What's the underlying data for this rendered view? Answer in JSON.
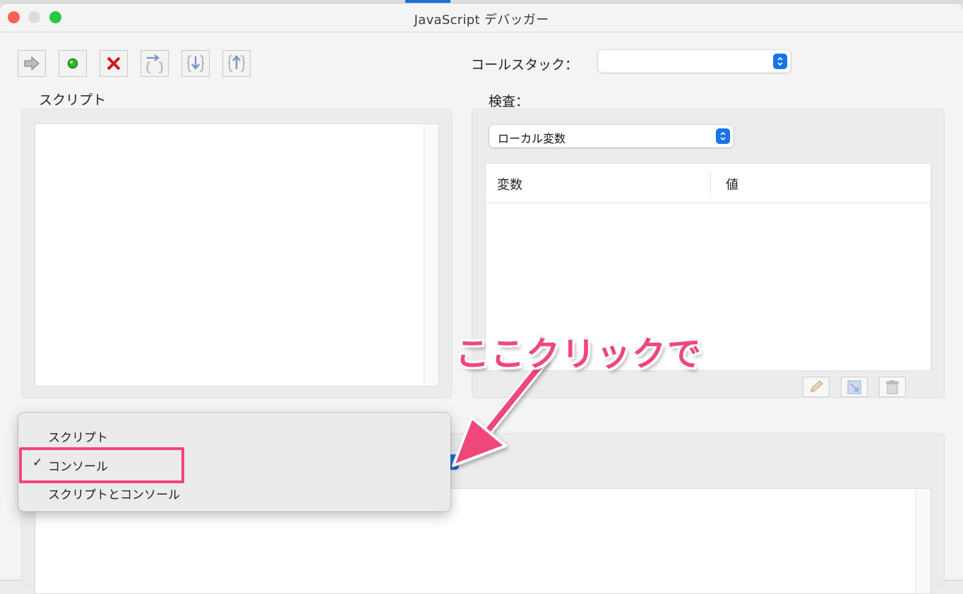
{
  "window": {
    "title": "JavaScript デバッガー"
  },
  "toolbar": {
    "buttons": [
      {
        "name": "continue-arrow-icon"
      },
      {
        "name": "break-green-dot-icon"
      },
      {
        "name": "stop-red-x-icon"
      },
      {
        "name": "step-over-icon"
      },
      {
        "name": "step-into-icon"
      },
      {
        "name": "step-out-icon"
      }
    ]
  },
  "callstack": {
    "label": "コールスタック：",
    "value": ""
  },
  "script_panel": {
    "label": "スクリプト"
  },
  "inspect_panel": {
    "label": "検査：",
    "select_value": "ローカル変数",
    "columns": [
      "変数",
      "値"
    ]
  },
  "popup_menu": {
    "items": [
      {
        "label": "スクリプト",
        "checked": false
      },
      {
        "label": "コンソール",
        "checked": true
      },
      {
        "label": "スクリプトとコンソール",
        "checked": false
      }
    ],
    "checkmark": "✓"
  },
  "annotation": {
    "text": "ここクリックで",
    "color": "#f0467a"
  },
  "colors": {
    "accent_blue": "#1a73e8",
    "close": "#ff5f57",
    "minimize": "#dcdcdc",
    "zoom": "#28c840",
    "highlight": "#f0467a"
  }
}
